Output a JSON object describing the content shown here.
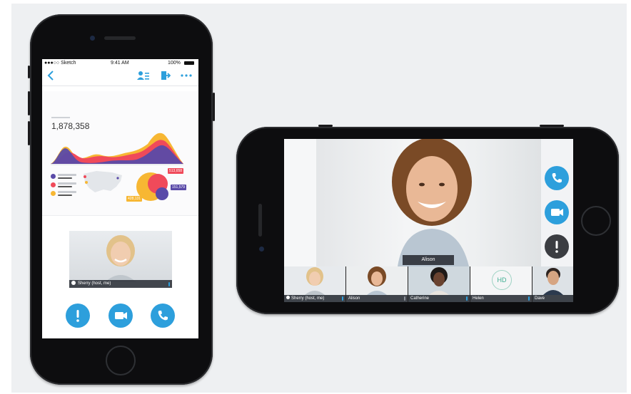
{
  "portrait": {
    "status_bar": {
      "carrier": "●●●○○ Sketch",
      "time": "9:41 AM",
      "battery": "100%"
    },
    "nav": {
      "back_icon": "chevron-left-icon",
      "participants_icon": "participants-list-icon",
      "leave_icon": "leave-icon",
      "more_icon": "more-icon"
    },
    "dashboard": {
      "headline_value": "1,878,358",
      "bubble_labels": [
        "513,658",
        "151,579",
        "428,131"
      ]
    },
    "video": {
      "label": "Sherry (host, me)"
    },
    "actions": [
      "alert-icon",
      "video-camera-icon",
      "phone-icon"
    ]
  },
  "landscape": {
    "active_speaker": "Alison",
    "participants": [
      {
        "name": "Sherry (host, me)"
      },
      {
        "name": "Alison"
      },
      {
        "name": "Catherine"
      },
      {
        "name": "Helen",
        "avatar_text": "HD"
      },
      {
        "name": "Dave"
      }
    ],
    "actions": [
      "phone-icon",
      "video-camera-icon",
      "alert-icon"
    ]
  },
  "colors": {
    "accent": "#2d9fdc",
    "purple": "#5a4aa8",
    "red": "#f04a5a",
    "yellow": "#f7b733",
    "dark_button": "#3b3d42"
  }
}
